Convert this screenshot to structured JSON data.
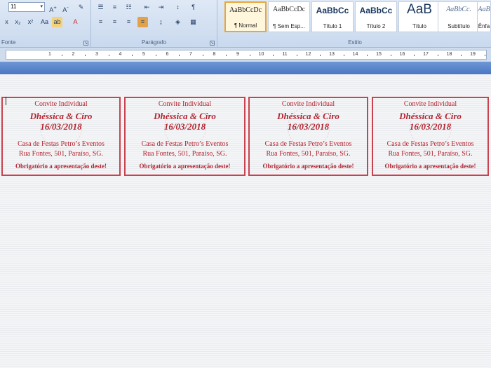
{
  "ribbon": {
    "font_group_label": "Fonte",
    "paragraph_group_label": "Parágrafo",
    "styles_group_label": "Estilo",
    "font_size": "11",
    "styles": [
      {
        "sample": "AaBbCcDc",
        "name": "¶ Normal"
      },
      {
        "sample": "AaBbCcDc",
        "name": "¶ Sem Esp..."
      },
      {
        "sample": "AaBbCc",
        "name": "Título 1"
      },
      {
        "sample": "AaBbCc",
        "name": "Título 2"
      },
      {
        "sample": "AaB",
        "name": "Título"
      },
      {
        "sample": "AaBbCc.",
        "name": "Subtítulo"
      },
      {
        "sample": "AaB",
        "name": "Ênfa"
      }
    ]
  },
  "ruler": {
    "numbers": [
      "1",
      "2",
      "3",
      "4",
      "5",
      "6",
      "7",
      "8",
      "9",
      "10",
      "11",
      "12",
      "13",
      "14",
      "15",
      "16",
      "17",
      "18",
      "19"
    ]
  },
  "cards": [
    {
      "title": "Convite Individual",
      "names": "Dhéssica & Ciro",
      "date": "16/03/2018",
      "venue": "Casa de Festas Petro’s Eventos",
      "address": "Rua Fontes, 501, Paraíso, SG.",
      "note": "Obrigatório a apresentação deste!"
    },
    {
      "title": "Convite Individual",
      "names": "Dhéssica & Ciro",
      "date": "16/03/2018",
      "venue": "Casa de Festas Petro’s Eventos",
      "address": "Rua Fontes, 501, Paraíso, SG.",
      "note": "Obrigatório a apresentação deste!"
    },
    {
      "title": "Convite Individual",
      "names": "Dhéssica & Ciro",
      "date": "16/03/2018",
      "venue": "Casa de Festas Petro’s Eventos",
      "address": "Rua Fontes, 501, Paraíso, SG.",
      "note": "Obrigatório a apresentação deste!"
    },
    {
      "title": "Convite Individual",
      "names": "Dhéssica & Ciro",
      "date": "16/03/2018",
      "venue": "Casa de Festas Petro’s Eventos",
      "address": "Rua Fontes, 501, Paraíso, SG.",
      "note": "Obrigatório a apresentação deste!"
    }
  ],
  "colors": {
    "invite_red": "#b3242f",
    "ribbon_blue": "#c9d9ee",
    "active_style": "#e8a73c"
  }
}
